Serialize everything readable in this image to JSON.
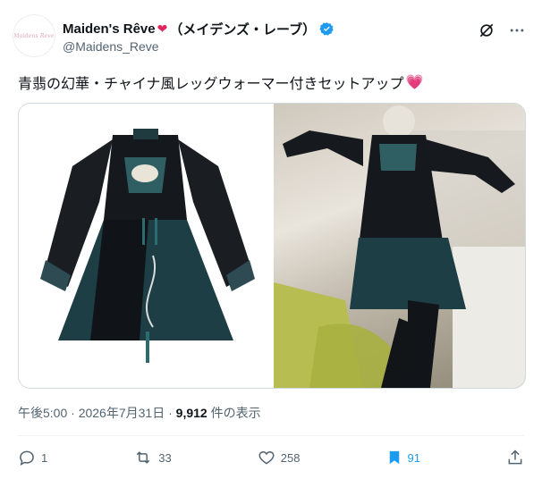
{
  "author": {
    "display_name": "Maiden's Rêve",
    "heart": "❤",
    "jp_name": "（メイデンズ・レーブ）",
    "handle": "@Maidens_Reve",
    "avatar_text": "Maidens Reve"
  },
  "tweet": {
    "text": "青翡の幻華・チャイナ風レッグウォーマー付きセットアップ",
    "emoji": "💗"
  },
  "meta": {
    "time": "午後5:00",
    "sep1": " · ",
    "date": "2026年7月31日",
    "sep2": " · ",
    "views": "9,912",
    "views_label": " 件の表示"
  },
  "actions": {
    "replies": "1",
    "retweets": "33",
    "likes": "258",
    "bookmarks": "91"
  },
  "icons": [
    "verified-icon",
    "grok-icon",
    "more-icon",
    "reply-icon",
    "retweet-icon",
    "like-icon",
    "bookmark-icon",
    "share-icon"
  ],
  "colors": {
    "accent": "#1d9bf0",
    "text": "#0f1419",
    "muted": "#536471",
    "heart": "#e0245e"
  }
}
